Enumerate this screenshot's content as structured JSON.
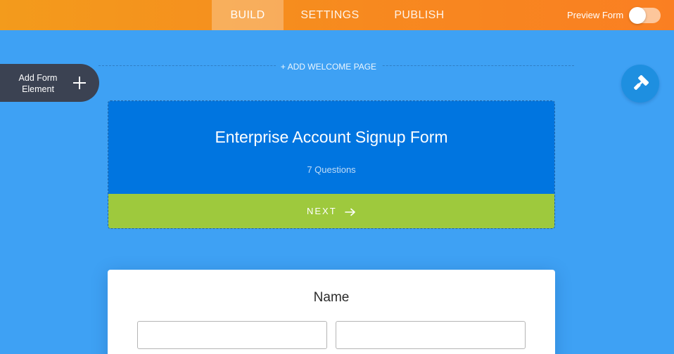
{
  "toolbar": {
    "tabs": [
      {
        "label": "BUILD",
        "active": true
      },
      {
        "label": "SETTINGS",
        "active": false
      },
      {
        "label": "PUBLISH",
        "active": false
      }
    ],
    "preview_label": "Preview Form",
    "preview_enabled": false
  },
  "canvas": {
    "add_welcome_label": "+ ADD WELCOME PAGE",
    "add_element_label": "Add Form Element",
    "designer_icon": "paint-roller-icon"
  },
  "header": {
    "title": "Enterprise Account Signup Form",
    "question_count": "7 Questions",
    "next_label": "NEXT"
  },
  "question": {
    "label": "Name",
    "first_value": "",
    "last_value": ""
  },
  "colors": {
    "topbar": "#f7891f",
    "background": "#3ea1f4",
    "header": "#0075e0",
    "next_bar": "#9ec93d"
  }
}
